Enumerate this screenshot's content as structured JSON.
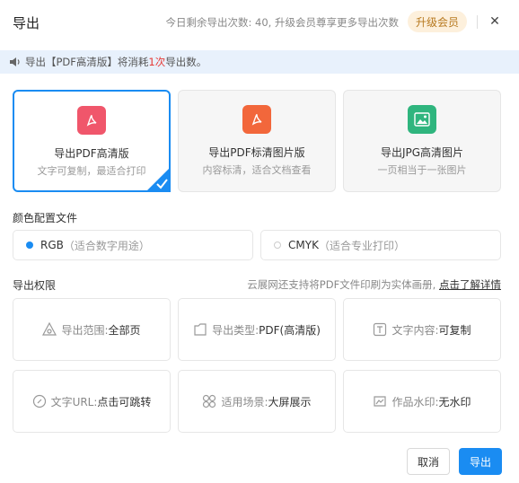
{
  "dialog": {
    "title": "导出",
    "remaining_text": "今日剩余导出次数: 40, 升级会员尊享更多导出次数",
    "vip_button": "升级会员",
    "close_glyph": "✕"
  },
  "notice": {
    "prefix": "导出【PDF高清版】将消耗",
    "count": "1次",
    "suffix": "导出数。"
  },
  "export_options": [
    {
      "title": "导出PDF高清版",
      "desc": "文字可复制，最适合打印",
      "icon": "pdf-icon",
      "color": "#f0566b",
      "selected": true
    },
    {
      "title": "导出PDF标清图片版",
      "desc": "内容标清，适合文档查看",
      "icon": "pdf-icon",
      "color": "#f2673b",
      "selected": false
    },
    {
      "title": "导出JPG高清图片",
      "desc": "一页相当于一张图片",
      "icon": "image-icon",
      "color": "#2fb57e",
      "selected": false
    }
  ],
  "color_profile": {
    "label": "颜色配置文件",
    "options": [
      {
        "name": "RGB",
        "note": "（适合数字用途）",
        "selected": true
      },
      {
        "name": "CMYK",
        "note": "（适合专业打印）",
        "selected": false
      }
    ]
  },
  "permissions": {
    "label": "导出权限",
    "note": "云展网还支持将PDF文件印刷为实体画册,",
    "link": "点击了解详情",
    "items": [
      {
        "key": "导出范围: ",
        "value": "全部页",
        "icon": "range-icon"
      },
      {
        "key": "导出类型: ",
        "value": "PDF(高清版)",
        "icon": "file-type-icon"
      },
      {
        "key": "文字内容: ",
        "value": "可复制",
        "icon": "text-icon"
      },
      {
        "key": "文字URL: ",
        "value": "点击可跳转",
        "icon": "link-icon"
      },
      {
        "key": "适用场景: ",
        "value": "大屏展示",
        "icon": "scene-icon"
      },
      {
        "key": "作品水印: ",
        "value": "无水印",
        "icon": "watermark-icon"
      }
    ]
  },
  "footer": {
    "cancel": "取消",
    "confirm": "导出"
  },
  "colors": {
    "accent": "#1a8cf2",
    "vip_bg": "#fdf0dc",
    "vip_text": "#b7791f",
    "notice_bg": "#e8f1fc"
  }
}
